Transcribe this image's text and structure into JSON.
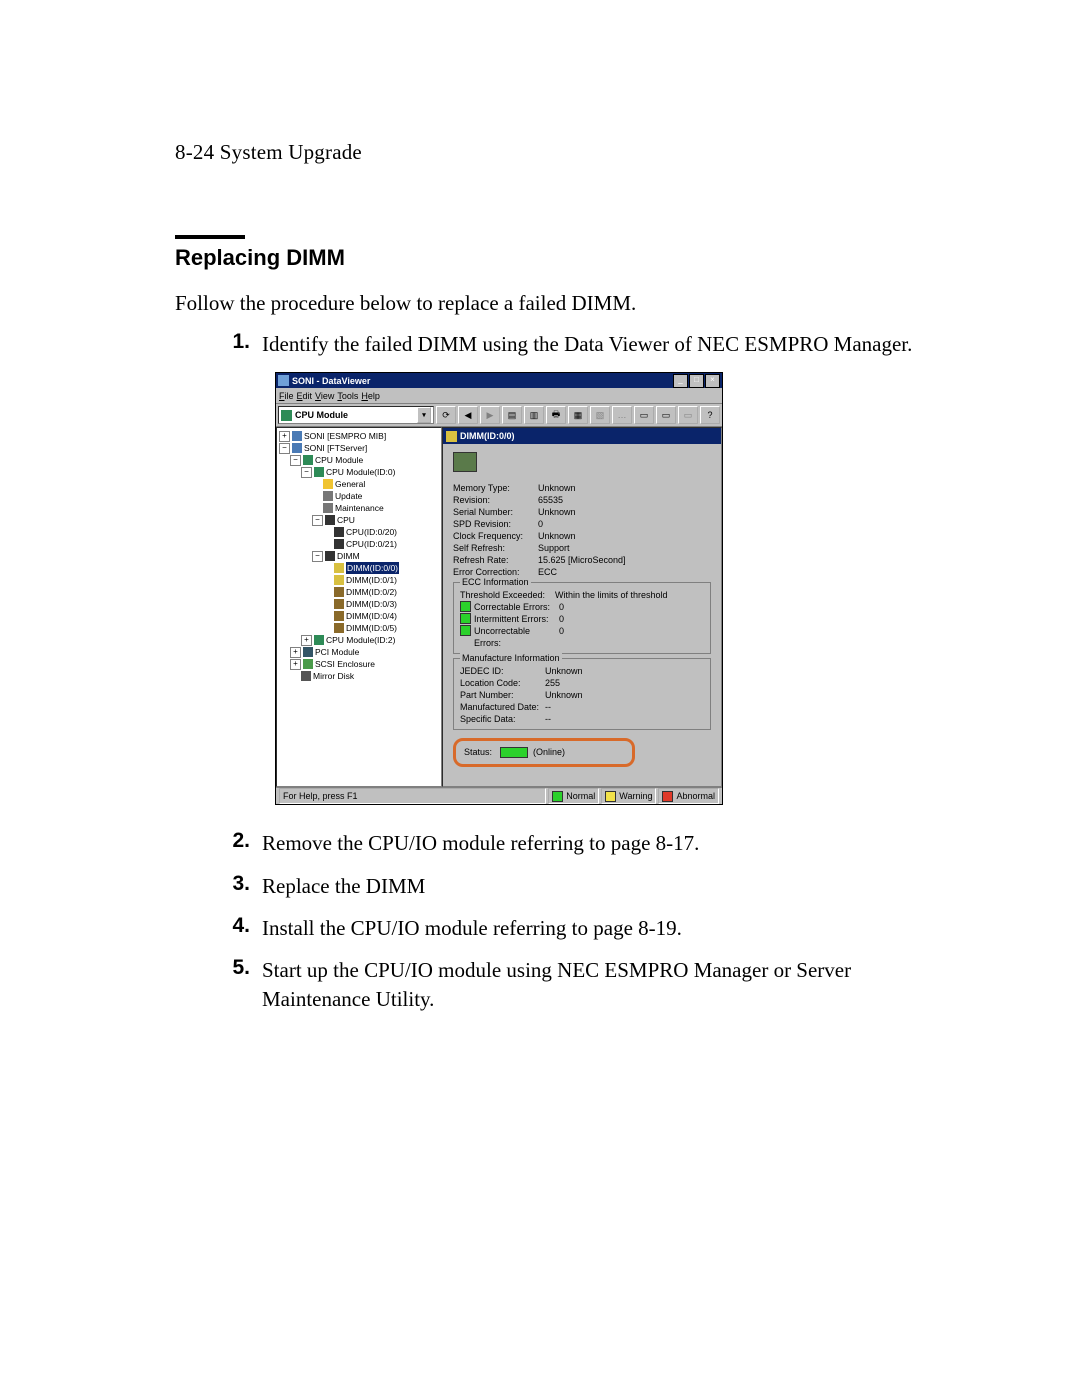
{
  "page_header": "8-24   System Upgrade",
  "section_title": "Replacing DIMM",
  "intro": "Follow the procedure below to replace a failed DIMM.",
  "steps": [
    "Identify the failed DIMM using the Data Viewer of NEC ESMPRO Manager.",
    "Remove the CPU/IO module referring to page 8-17.",
    "Replace the DIMM",
    "Install the CPU/IO module referring to page 8-19.",
    "Start up the CPU/IO module using NEC ESMPRO Manager or Server Maintenance Utility."
  ],
  "window": {
    "title": "SONI - DataViewer",
    "menu": [
      "File",
      "Edit",
      "View",
      "Tools",
      "Help"
    ],
    "combo": "CPU Module",
    "tree": {
      "root": "SONI [ESMPRO MIB]",
      "srv": "SONI [FTServer]",
      "cpu_module": "CPU Module",
      "cpu_mod0": "CPU Module(ID:0)",
      "general": "General",
      "update": "Update",
      "maintenance": "Maintenance",
      "cpu": "CPU",
      "cpu0": "CPU(ID:0/20)",
      "cpu1": "CPU(ID:0/21)",
      "dimm": "DIMM",
      "dimms": [
        "DIMM(ID:0/0)",
        "DIMM(ID:0/1)",
        "DIMM(ID:0/2)",
        "DIMM(ID:0/3)",
        "DIMM(ID:0/4)",
        "DIMM(ID:0/5)"
      ],
      "cpu_mod2": "CPU Module(ID:2)",
      "pci": "PCI Module",
      "scsi": "SCSI Enclosure",
      "mirror": "Mirror Disk"
    },
    "detail": {
      "title": "DIMM(ID:0/0)",
      "memory_type": {
        "k": "Memory Type:",
        "v": "Unknown"
      },
      "revision": {
        "k": "Revision:",
        "v": "65535"
      },
      "serial": {
        "k": "Serial Number:",
        "v": "Unknown"
      },
      "spd": {
        "k": "SPD Revision:",
        "v": "0"
      },
      "clock": {
        "k": "Clock Frequency:",
        "v": "Unknown"
      },
      "self_refresh": {
        "k": "Self Refresh:",
        "v": "Support"
      },
      "refresh_rate": {
        "k": "Refresh Rate:",
        "v": "15.625 [MicroSecond]"
      },
      "error_corr": {
        "k": "Error Correction:",
        "v": "ECC"
      },
      "ecc_caption": "ECC Information",
      "threshold": {
        "k": "Threshold Exceeded:",
        "v": "Within the limits of threshold"
      },
      "correctable": {
        "k": "Correctable Errors:",
        "v": "0"
      },
      "intermittent": {
        "k": "Intermittent Errors:",
        "v": "0"
      },
      "uncorrectable": {
        "k": "Uncorrectable Errors:",
        "v": "0"
      },
      "manu_caption": "Manufacture Information",
      "jedec": {
        "k": "JEDEC ID:",
        "v": "Unknown"
      },
      "location": {
        "k": "Location Code:",
        "v": "255"
      },
      "part": {
        "k": "Part Number:",
        "v": "Unknown"
      },
      "manu_date": {
        "k": "Manufactured Date:",
        "v": "--"
      },
      "specific": {
        "k": "Specific Data:",
        "v": "--"
      },
      "status_label": "Status:",
      "status_value": "(Online)"
    },
    "statusbar": {
      "help": "For Help, press F1",
      "normal": "Normal",
      "warning": "Warning",
      "abnormal": "Abnormal"
    }
  }
}
